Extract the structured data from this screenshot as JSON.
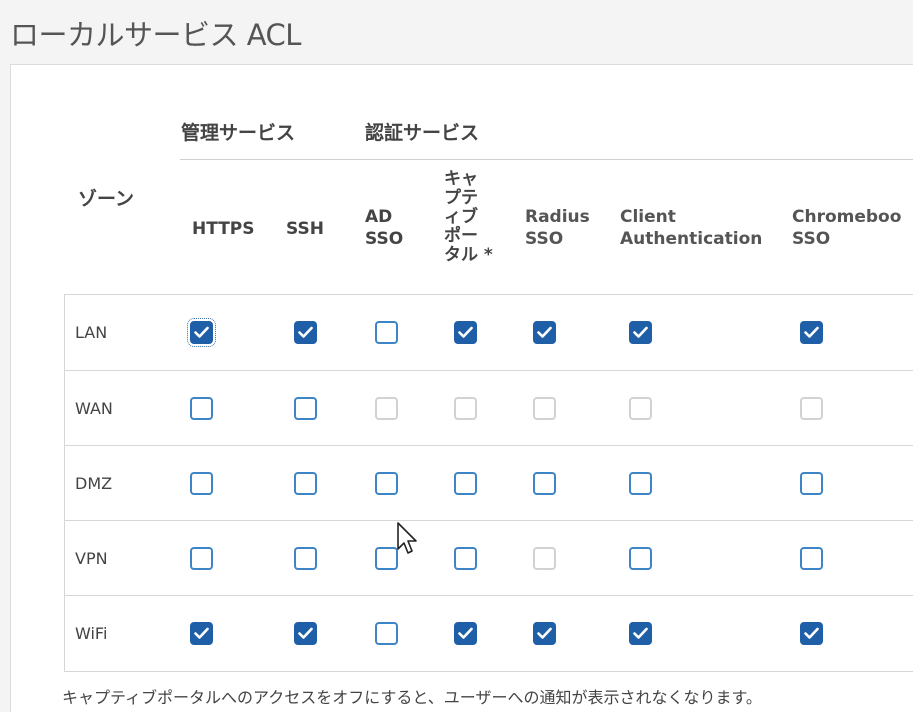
{
  "page": {
    "title": "ローカルサービス ACL"
  },
  "groups": {
    "management": "管理サービス",
    "auth": "認証サービス"
  },
  "zone_header": "ゾーン",
  "columns": {
    "https": "HTTPS",
    "ssh": "SSH",
    "ad_sso_1": "AD",
    "ad_sso_2": "SSO",
    "captive": "キャ\nプテ\nィブ\nポー\nタル *",
    "radius_1": "Radius",
    "radius_2": "SSO",
    "client_1": "Client",
    "client_2": "Authentication",
    "chrome_1": "Chromeboo",
    "chrome_2": "SSO"
  },
  "rows": [
    {
      "label": "LAN"
    },
    {
      "label": "WAN"
    },
    {
      "label": "DMZ"
    },
    {
      "label": "VPN"
    },
    {
      "label": "WiFi"
    }
  ],
  "states": {
    "LAN": [
      "checked",
      "checked",
      "unchecked",
      "checked",
      "checked",
      "checked",
      "checked"
    ],
    "WAN": [
      "unchecked",
      "unchecked",
      "disabled",
      "disabled",
      "disabled",
      "disabled",
      "disabled"
    ],
    "DMZ": [
      "unchecked",
      "unchecked",
      "unchecked",
      "unchecked",
      "unchecked",
      "unchecked",
      "unchecked"
    ],
    "VPN": [
      "unchecked",
      "unchecked",
      "unchecked",
      "unchecked",
      "disabled",
      "unchecked",
      "unchecked"
    ],
    "WiFi": [
      "checked",
      "checked",
      "unchecked",
      "checked",
      "checked",
      "checked",
      "checked"
    ]
  },
  "footnote": "キャプティブポータルへのアクセスをオフにすると、ユーザーへの通知が表示されなくなります。",
  "colors": {
    "checked": "#1f5fa8",
    "unchecked_border": "#3d85c6",
    "disabled_border": "#d2d2d2"
  }
}
